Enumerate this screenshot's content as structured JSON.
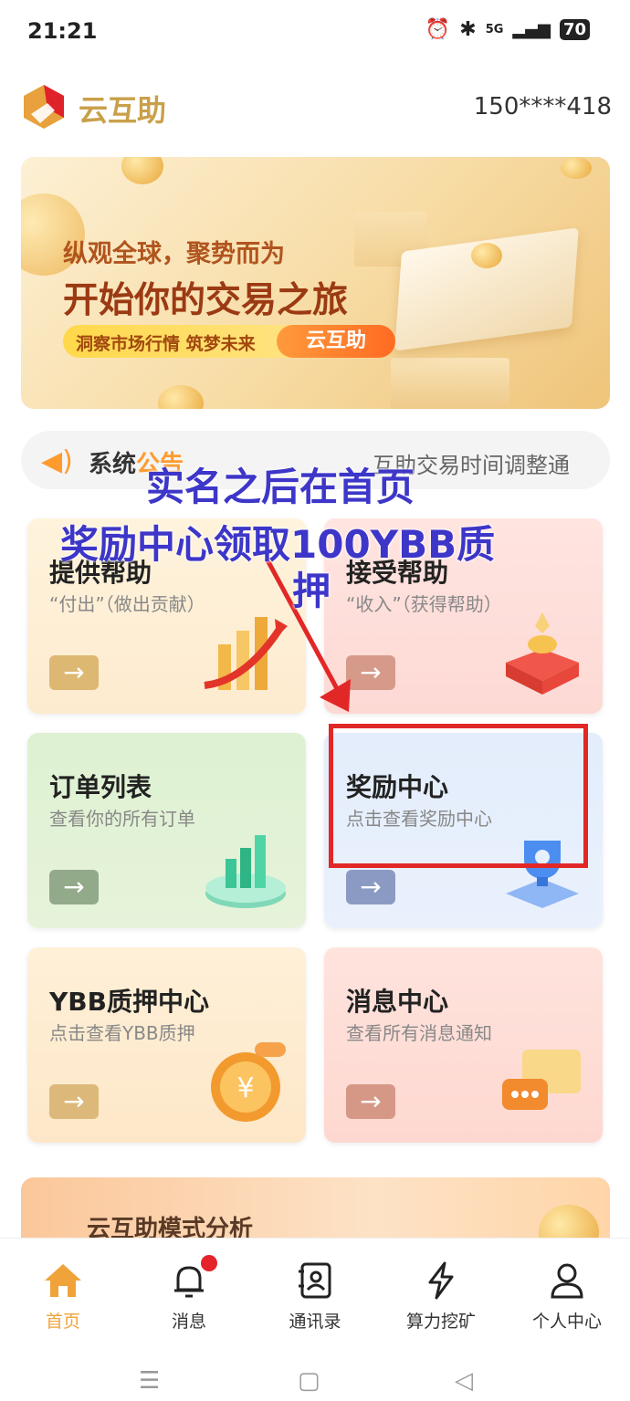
{
  "status_bar": {
    "time": "21:21",
    "network": "5G",
    "battery": "70"
  },
  "header": {
    "app_name": "云互助",
    "phone": "150****418"
  },
  "banner": {
    "line1": "纵观全球，聚势而为",
    "line2": "开始你的交易之旅",
    "pill_text": "洞察市场行情 筑梦未来",
    "pill_button": "云互助"
  },
  "notice": {
    "label_prefix": "系统",
    "label_suffix": "公告",
    "message": "互助交易时间调整通"
  },
  "overlay": {
    "line1": "实名之后在首页",
    "line2": "奖励中心领取100YBB质",
    "line3": "押"
  },
  "cards": [
    {
      "title": "提供帮助",
      "subtitle": "“付出”（做出贡献）",
      "arrow": "→"
    },
    {
      "title": "接受帮助",
      "subtitle": "“收入”（获得帮助）",
      "arrow": "→"
    },
    {
      "title": "订单列表",
      "subtitle": "查看你的所有订单",
      "arrow": "→"
    },
    {
      "title": "奖励中心",
      "subtitle": "点击查看奖励中心",
      "arrow": "→"
    },
    {
      "title": "YBB质押中心",
      "subtitle": "点击查看YBB质押",
      "arrow": "→"
    },
    {
      "title": "消息中心",
      "subtitle": "查看所有消息通知",
      "arrow": "→"
    }
  ],
  "analysis": {
    "title": "云互助模式分析"
  },
  "tabbar": [
    {
      "label": "首页",
      "icon": "home-icon"
    },
    {
      "label": "消息",
      "icon": "bell-icon"
    },
    {
      "label": "通讯录",
      "icon": "contacts-icon"
    },
    {
      "label": "算力挖矿",
      "icon": "lightning-icon"
    },
    {
      "label": "个人中心",
      "icon": "user-icon"
    }
  ],
  "colors": {
    "accent": "#f0a33a",
    "overlay_text": "#3d36c8",
    "highlight": "#e22727"
  }
}
